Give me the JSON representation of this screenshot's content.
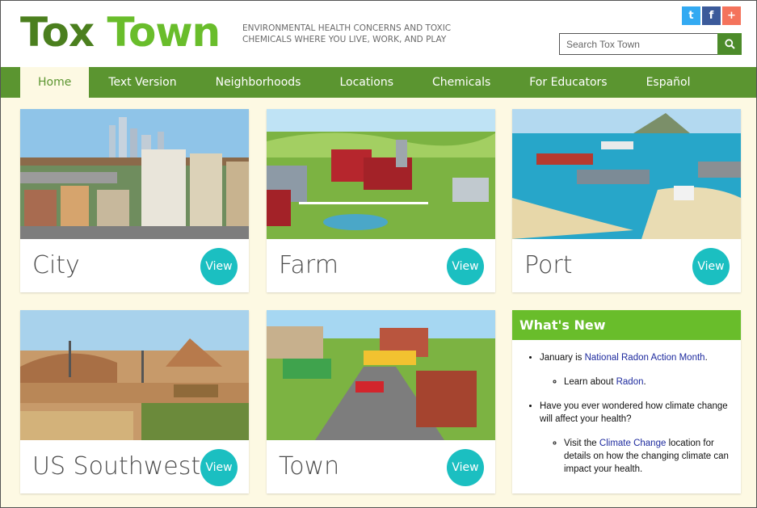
{
  "header": {
    "logo_word1": "Tox",
    "logo_word2": "Town",
    "tagline": "ENVIRONMENTAL HEALTH CONCERNS AND TOXIC CHEMICALS WHERE YOU LIVE, WORK, AND PLAY",
    "social": [
      {
        "icon": "twitter-icon",
        "glyph": "t",
        "color": "#33aaf2"
      },
      {
        "icon": "facebook-icon",
        "glyph": "f",
        "color": "#3b5a9a"
      },
      {
        "icon": "share-plus-icon",
        "glyph": "+",
        "color": "#f4735c"
      }
    ],
    "search": {
      "placeholder": "Search Tox Town",
      "value": ""
    }
  },
  "nav": {
    "items": [
      "Home",
      "Text Version",
      "Neighborhoods",
      "Locations",
      "Chemicals",
      "For Educators",
      "Español"
    ],
    "active": "Home"
  },
  "cards": [
    {
      "name": "City",
      "button": "View"
    },
    {
      "name": "Farm",
      "button": "View"
    },
    {
      "name": "Port",
      "button": "View"
    },
    {
      "name": "US Southwest",
      "button": "View"
    },
    {
      "name": "Town",
      "button": "View"
    }
  ],
  "whats_new": {
    "title": "What's New",
    "item1_prefix": "January is ",
    "item1_link": "National Radon Action Month",
    "item1_suffix": ".",
    "sub1_prefix": "Learn about ",
    "sub1_link": "Radon",
    "sub1_suffix": ".",
    "item2": "Have you ever wondered how climate change will affect your health?",
    "sub2_prefix": "Visit the ",
    "sub2_link": "Climate Change",
    "sub2_suffix": " location for details on how the changing climate can impact your health."
  },
  "colors": {
    "nav_green": "#5b9530",
    "logo_dark": "#4b7f1e",
    "logo_light": "#69bd2b",
    "view_teal": "#1bbfc1",
    "background": "#fdf9e3",
    "link_blue": "#1d2a9e"
  }
}
